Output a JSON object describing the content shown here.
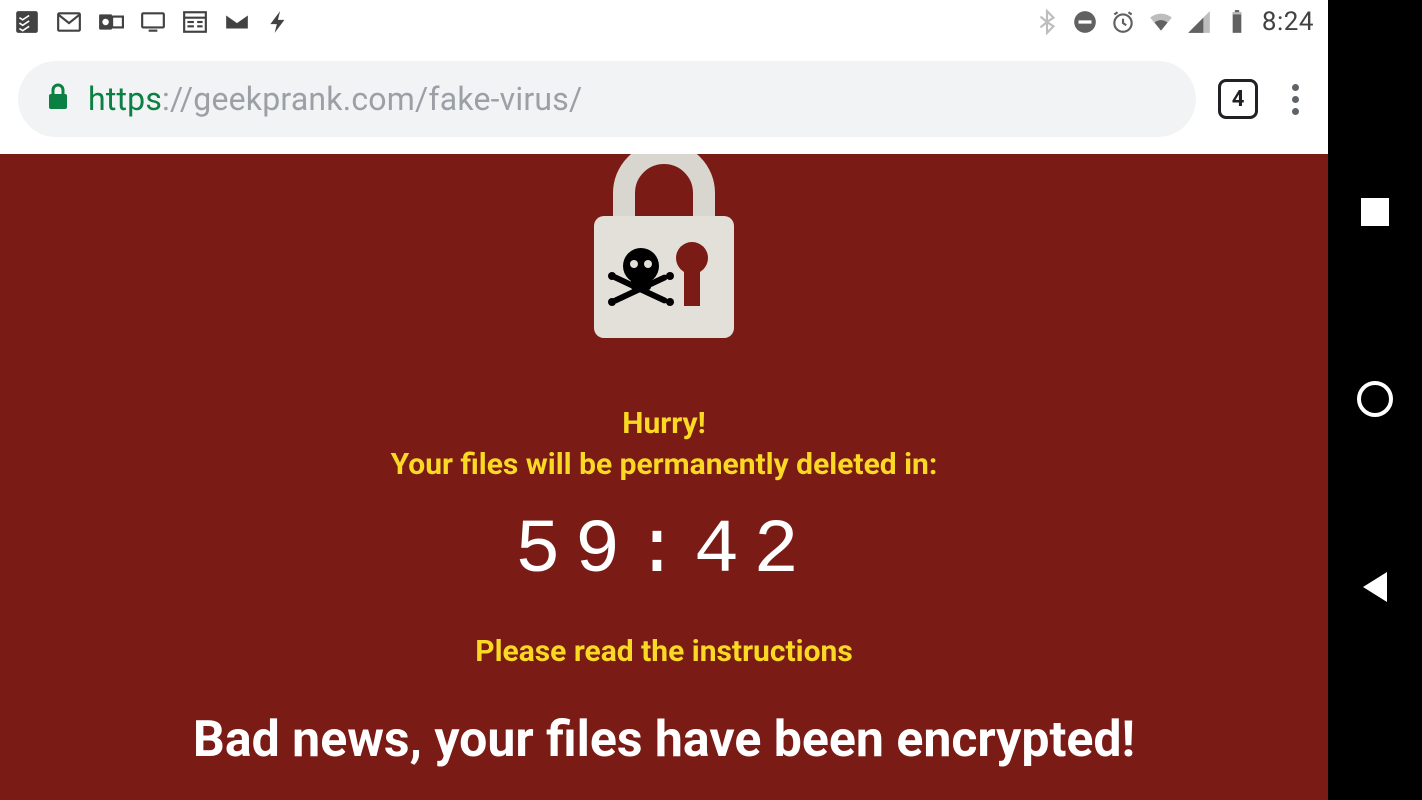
{
  "statusbar": {
    "clock": "8:24",
    "left_icons": [
      "todoist-icon",
      "gmail-icon",
      "outlook-icon",
      "display-icon",
      "news-icon",
      "mail-icon",
      "flash-icon"
    ],
    "right_icons": [
      "bluetooth-icon",
      "dnd-icon",
      "alarm-icon",
      "wifi-icon",
      "cell-icon",
      "battery-icon"
    ]
  },
  "browser": {
    "url_scheme": "https",
    "url_rest": "://geekprank.com/fake-virus/",
    "tab_count": "4"
  },
  "page": {
    "hurry": "Hurry!",
    "warning": "Your files will be permanently deleted in:",
    "countdown": "59:42",
    "instructions": "Please read the instructions",
    "headline": "Bad news, your files have been encrypted!"
  },
  "colors": {
    "page_bg": "#7b1b15",
    "accent_yellow": "#f9d923",
    "scheme_green": "#0b8043"
  }
}
